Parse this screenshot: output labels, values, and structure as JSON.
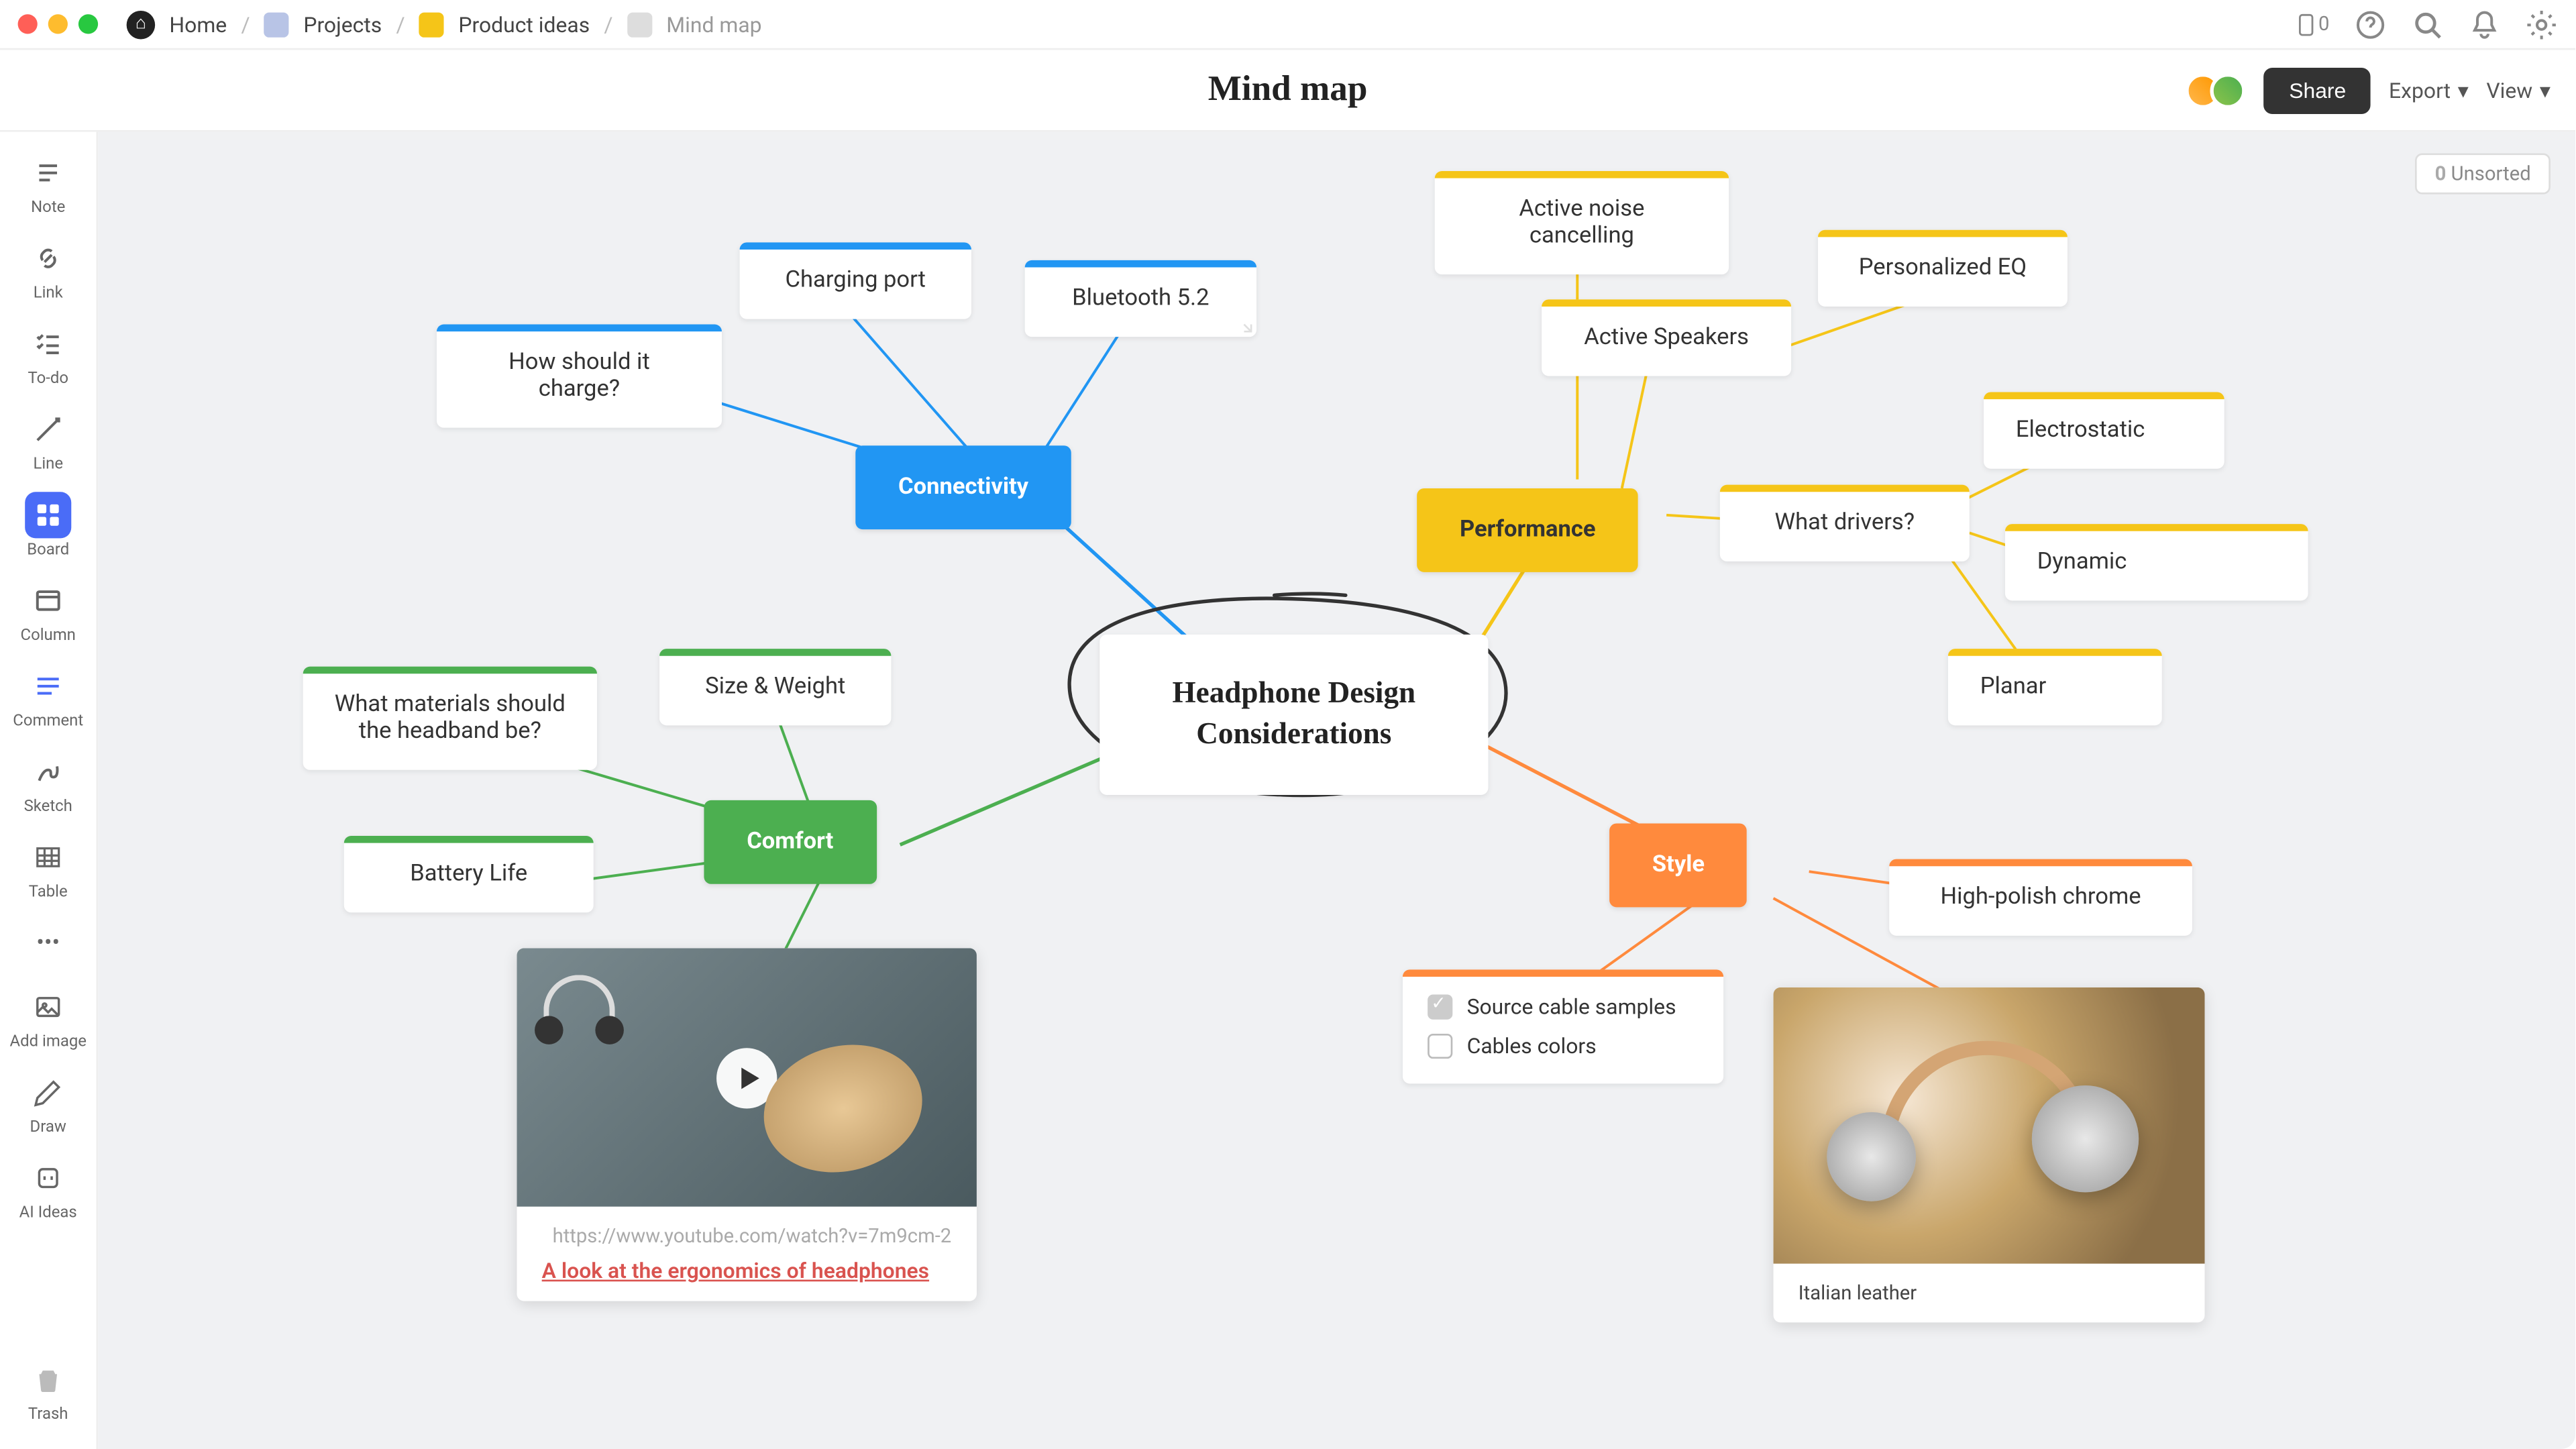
{
  "breadcrumb": {
    "home": "Home",
    "projects": "Projects",
    "product_ideas": "Product ideas",
    "current": "Mind map"
  },
  "device_count": "0",
  "page_title": "Mind map",
  "share_label": "Share",
  "export_label": "Export",
  "view_label": "View",
  "unsorted": {
    "count": "0",
    "label": "Unsorted"
  },
  "tools": {
    "note": "Note",
    "link": "Link",
    "todo": "To-do",
    "line": "Line",
    "board": "Board",
    "column": "Column",
    "comment": "Comment",
    "sketch": "Sketch",
    "table": "Table",
    "add_image": "Add image",
    "draw": "Draw",
    "ai": "AI Ideas",
    "trash": "Trash"
  },
  "center": "Headphone Design Considerations",
  "hubs": {
    "connectivity": "Connectivity",
    "performance": "Performance",
    "comfort": "Comfort",
    "style": "Style"
  },
  "nodes": {
    "charge_q": "How should it charge?",
    "charging_port": "Charging port",
    "bluetooth": "Bluetooth 5.2",
    "anc": "Active noise cancelling",
    "active_speakers": "Active Speakers",
    "eq": "Personalized EQ",
    "drivers_q": "What drivers?",
    "electrostatic": "Electrostatic",
    "dynamic": "Dynamic",
    "planar": "Planar",
    "materials_q": "What materials should the headband be?",
    "size_weight": "Size & Weight",
    "battery": "Battery Life",
    "chrome": "High-polish chrome",
    "checklist": {
      "item1": "Source cable samples",
      "item2": "Cables colors"
    },
    "image_caption": "Italian leather"
  },
  "video": {
    "url": "https://www.youtube.com/watch?v=7m9cm-2l",
    "title": "A look at the ergonomics of headphones"
  },
  "colors": {
    "blue": "#2196f3",
    "yellow": "#f5c518",
    "green": "#4caf50",
    "orange": "#ff8a3d"
  }
}
